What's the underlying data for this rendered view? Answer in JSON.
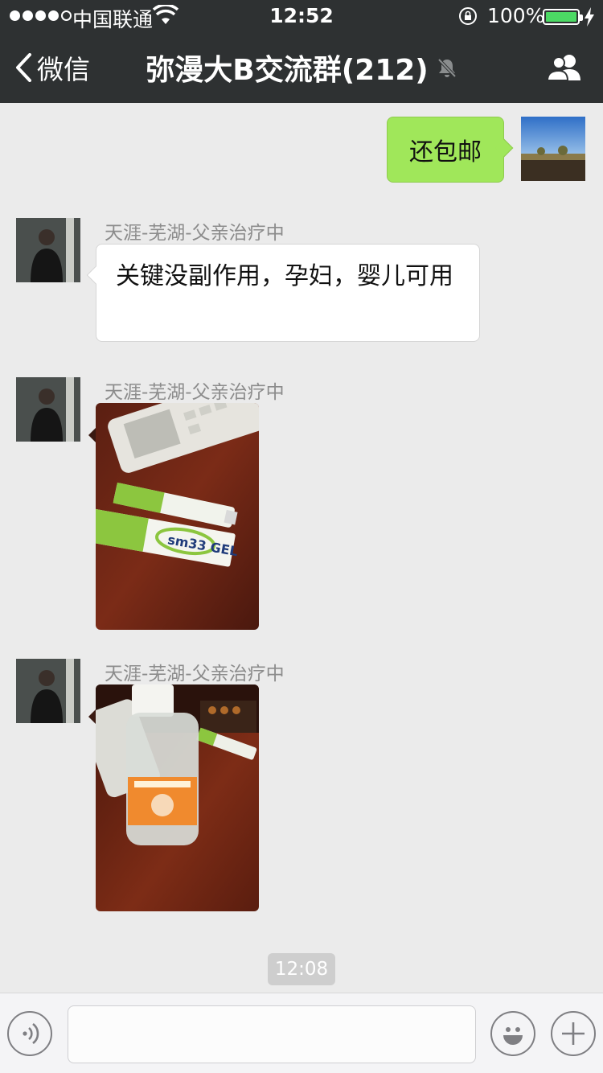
{
  "status_bar": {
    "carrier": "中国联通",
    "time": "12:52",
    "battery_percent": "100%",
    "battery_level": 1.0,
    "signal_bars": 4,
    "signal_max": 5,
    "icons": [
      "wifi-icon",
      "orientation-lock-icon",
      "battery-icon",
      "charging-icon"
    ]
  },
  "nav": {
    "back_label": "微信",
    "title": "弥漫大B交流群(212)",
    "icons": [
      "chevron-left-icon",
      "mute-icon",
      "group-members-icon"
    ]
  },
  "messages": [
    {
      "type": "text",
      "direction": "outgoing",
      "text": "还包邮"
    },
    {
      "type": "text",
      "direction": "incoming",
      "sender": "天涯-芜湖-父亲治疗中",
      "text": "关键没副作用，孕妇，婴儿可用"
    },
    {
      "type": "image",
      "direction": "incoming",
      "sender": "天涯-芜湖-父亲治疗中",
      "image_text": "sm33 GEL"
    },
    {
      "type": "image",
      "direction": "incoming",
      "sender": "天涯-芜湖-父亲治疗中"
    }
  ],
  "timestamp": "12:08",
  "input_bar": {
    "value": "",
    "icons": [
      "voice-icon",
      "emoji-icon",
      "plus-icon"
    ]
  },
  "colors": {
    "nav_background": "#2e3132",
    "chat_background": "#ebebeb",
    "outgoing_bubble": "#a0e75a",
    "incoming_bubble": "#ffffff",
    "battery_fill": "#4cd964"
  }
}
